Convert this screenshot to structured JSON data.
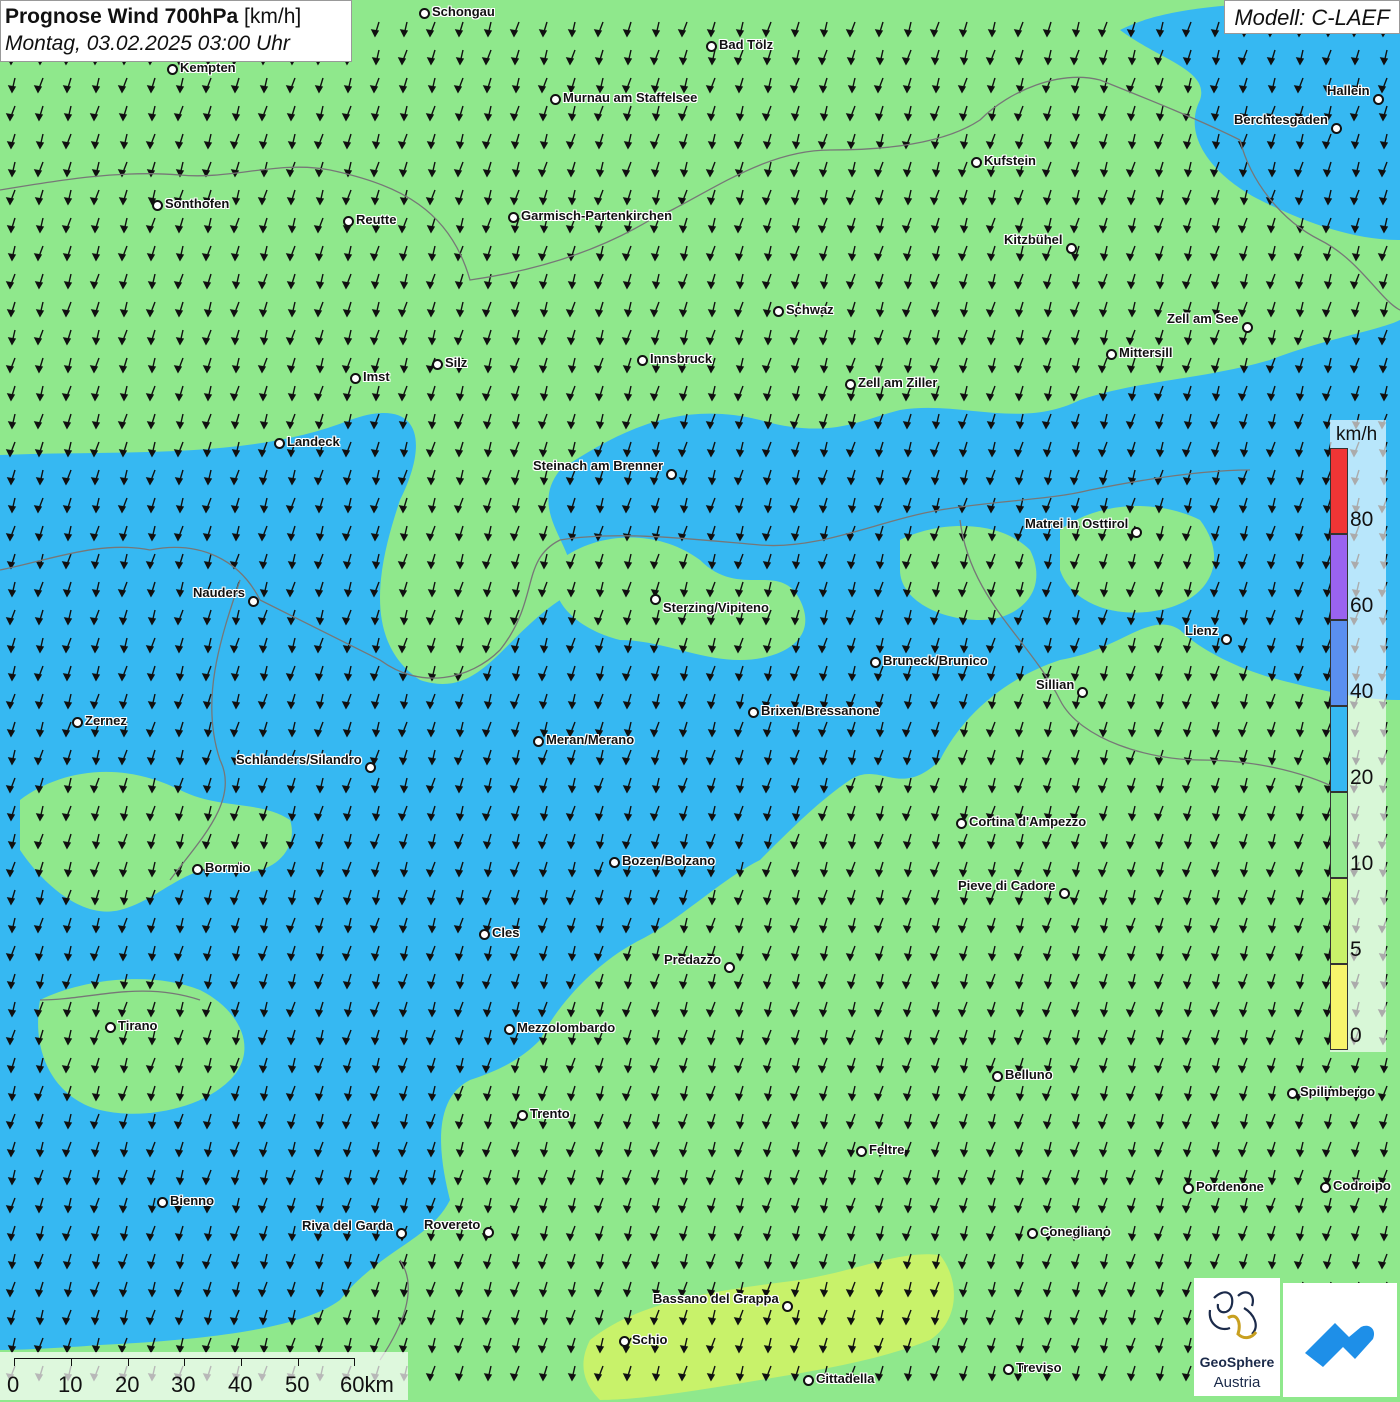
{
  "header": {
    "title_bold": "Prognose Wind 700hPa",
    "title_unit": " [km/h]",
    "datetime": "Montag, 03.02.2025 03:00 Uhr"
  },
  "model": "Modell: C-LAEF",
  "legend": {
    "unit": "km/h",
    "values": [
      "80",
      "60",
      "40",
      "20",
      "10",
      "5",
      "0"
    ],
    "colors": [
      "#f03535",
      "#9a63f0",
      "#5a8ff0",
      "#36b8f2",
      "#8fe88c",
      "#c8f26a",
      "#f7f56c"
    ]
  },
  "scalebar": {
    "labels": [
      "0",
      "10",
      "20",
      "30",
      "40",
      "50",
      "60km"
    ]
  },
  "logos": {
    "geosphere_line1": "GeoSphere",
    "geosphere_line2": "Austria"
  },
  "colors": {
    "wind_10_20": "#8fe88c",
    "wind_20_40": "#36b8f2",
    "wind_5_10": "#c8f26a",
    "wind_0_5": "#f7f56c"
  },
  "cities": [
    {
      "name": "Schongau"
    },
    {
      "name": "Bad Tölz"
    },
    {
      "name": "Kempten"
    },
    {
      "name": "Hallein"
    },
    {
      "name": "Murnau am Staffelsee"
    },
    {
      "name": "Berchtesgaden"
    },
    {
      "name": "Kufstein"
    },
    {
      "name": "Sonthofen"
    },
    {
      "name": "Reutte"
    },
    {
      "name": "Garmisch-Partenkirchen"
    },
    {
      "name": "Kitzbühel"
    },
    {
      "name": "Schwaz"
    },
    {
      "name": "Zell am See"
    },
    {
      "name": "Imst"
    },
    {
      "name": "Silz"
    },
    {
      "name": "Innsbruck"
    },
    {
      "name": "Mittersill"
    },
    {
      "name": "Zell am Ziller"
    },
    {
      "name": "Landeck"
    },
    {
      "name": "Steinach am Brenner"
    },
    {
      "name": "Matrei in Osttirol"
    },
    {
      "name": "Nauders"
    },
    {
      "name": "Sterzing/Vipiteno"
    },
    {
      "name": "Lienz"
    },
    {
      "name": "Bruneck/Brunico"
    },
    {
      "name": "Sillian"
    },
    {
      "name": "Zernez"
    },
    {
      "name": "Brixen/Bressanone"
    },
    {
      "name": "Meran/Merano"
    },
    {
      "name": "Schlanders/Silandro"
    },
    {
      "name": "Cortina d'Ampezzo"
    },
    {
      "name": "Bozen/Bolzano"
    },
    {
      "name": "Bormio"
    },
    {
      "name": "Pieve di Cadore"
    },
    {
      "name": "Cles"
    },
    {
      "name": "Predazzo"
    },
    {
      "name": "Tirano"
    },
    {
      "name": "Mezzolombardo"
    },
    {
      "name": "Belluno"
    },
    {
      "name": "Spilimbergo"
    },
    {
      "name": "Trento"
    },
    {
      "name": "Feltre"
    },
    {
      "name": "Pordenone"
    },
    {
      "name": "Codroipo"
    },
    {
      "name": "Bienno"
    },
    {
      "name": "Riva del Garda"
    },
    {
      "name": "Rovereto"
    },
    {
      "name": "Conegliano"
    },
    {
      "name": "Bassano del Grappa"
    },
    {
      "name": "Schio"
    },
    {
      "name": "Treviso"
    },
    {
      "name": "Cittadella"
    }
  ]
}
